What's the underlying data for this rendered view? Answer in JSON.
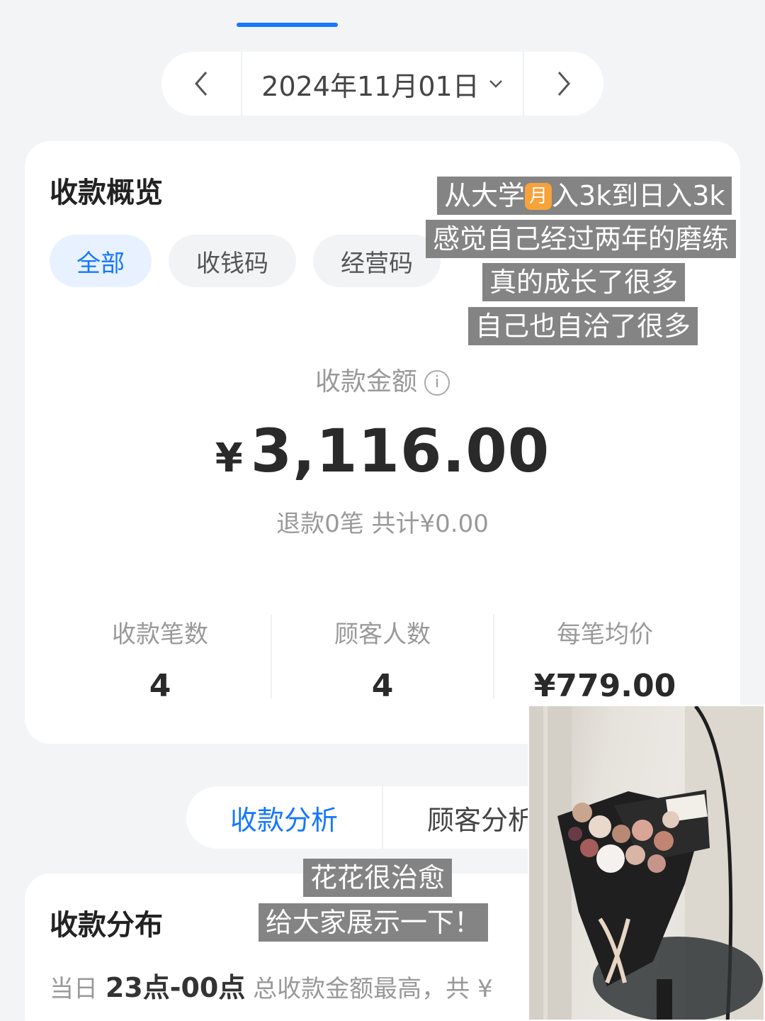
{
  "date_nav": {
    "date": "2024年11月01日",
    "prev_icon": "chevron-left-icon",
    "next_icon": "chevron-right-icon"
  },
  "overview": {
    "title": "收款概览",
    "chips": [
      "全部",
      "收钱码",
      "经营码"
    ],
    "amount_label": "收款金额",
    "info_icon": "i",
    "currency": "¥",
    "amount": "3,116.00",
    "refund": "退款0笔  共计¥0.00",
    "stats": [
      {
        "label": "收款笔数",
        "value": "4"
      },
      {
        "label": "顾客人数",
        "value": "4"
      },
      {
        "label": "每笔均价",
        "value": "¥779.00"
      }
    ]
  },
  "analysis_tabs": [
    "收款分析",
    "顾客分析"
  ],
  "distribution": {
    "title": "收款分布",
    "prefix": "当日",
    "time_range": "23点-00点",
    "suffix": "总收款金额最高，共",
    "trailing": "¥"
  },
  "overlay_text": {
    "line1_a": "从大学",
    "line1_icon": "月",
    "line1_b": "入3k到日入3k",
    "line2": "感觉自己经过两年的磨练",
    "line3": "真的成长了很多",
    "line4": "自己也自洽了很多",
    "line5": "花花很治愈",
    "line6": "给大家展示一下！"
  },
  "colors": {
    "accent": "#1677ff",
    "background": "#f3f4f6",
    "card": "#ffffff"
  }
}
